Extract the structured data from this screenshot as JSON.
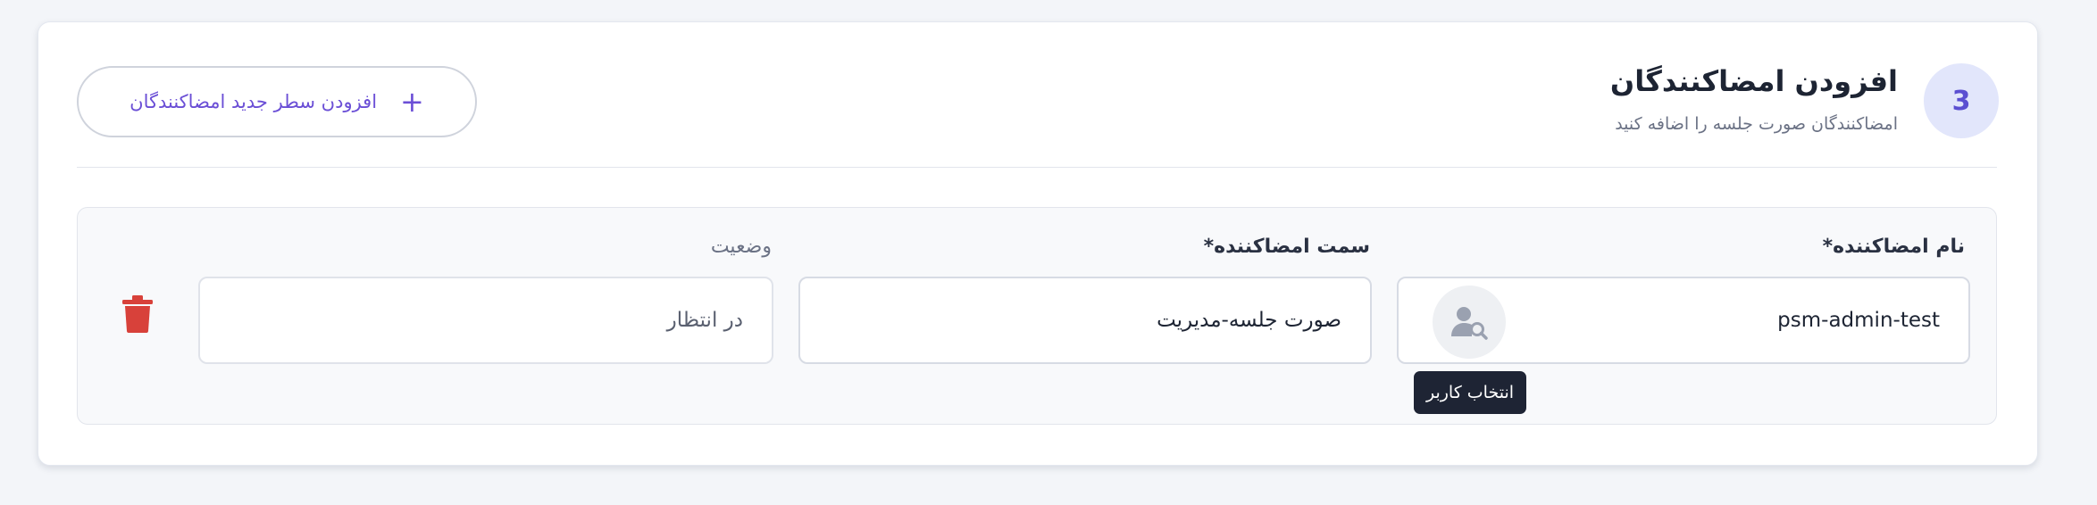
{
  "section": {
    "step_number": "3",
    "title": "افزودن امضاکنندگان",
    "subtitle": "امضاکنندگان صورت جلسه را اضافه کنید",
    "add_row_label": "افزودن سطر جدید امضاکنندگان",
    "add_row_icon": "plus-icon"
  },
  "signer_row": {
    "name_label": "نام امضاکننده*",
    "name_value": "psm-admin-test",
    "select_user_icon": "user-search-icon",
    "select_user_tooltip": "انتخاب کاربر",
    "position_label": "سمت امضاکننده*",
    "position_value": "صورت جلسه-مدیریت",
    "status_label": "وضعیت",
    "status_value": "در انتظار",
    "delete_icon": "trash-icon"
  },
  "colors": {
    "accent": "#6b4fd6",
    "step_badge_bg": "#e2e6fb",
    "delete": "#d8413a",
    "tooltip_bg": "#1e2434"
  }
}
